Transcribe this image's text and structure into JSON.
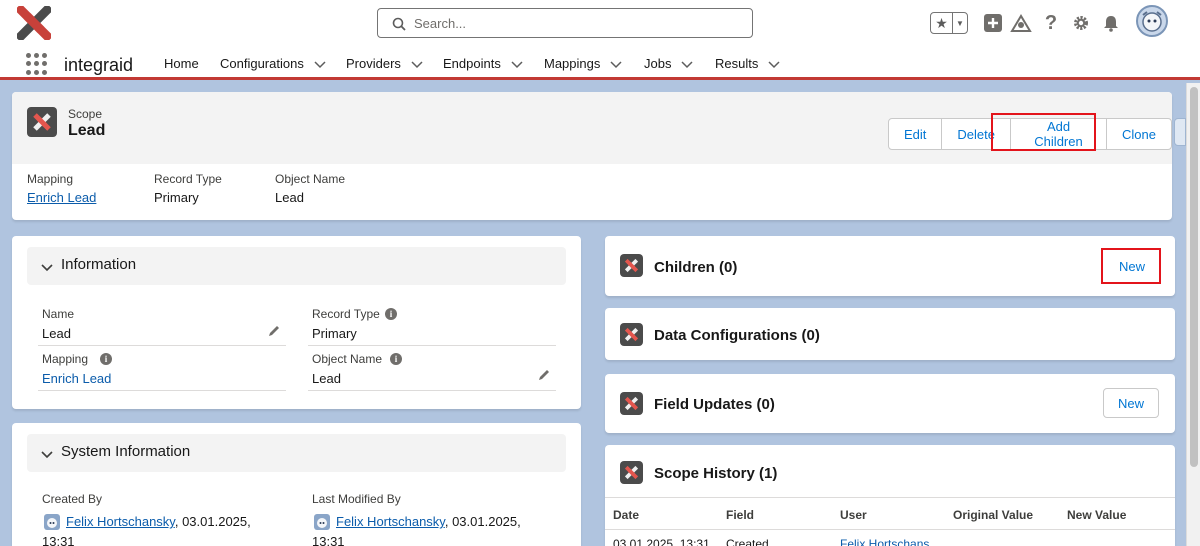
{
  "header": {
    "search_placeholder": "Search...",
    "icons": [
      "favorites-star-icon",
      "favorites-dropdown-icon",
      "global-add-icon",
      "trailhead-icon",
      "help-icon",
      "setup-gear-icon",
      "notifications-bell-icon",
      "user-avatar"
    ]
  },
  "nav": {
    "app_name": "integraid",
    "items": [
      {
        "label": "Home",
        "has_menu": false
      },
      {
        "label": "Configurations",
        "has_menu": true
      },
      {
        "label": "Providers",
        "has_menu": true
      },
      {
        "label": "Endpoints",
        "has_menu": true
      },
      {
        "label": "Mappings",
        "has_menu": true
      },
      {
        "label": "Jobs",
        "has_menu": true
      },
      {
        "label": "Results",
        "has_menu": true
      }
    ]
  },
  "record": {
    "object_label": "Scope",
    "name": "Lead",
    "actions": {
      "edit": "Edit",
      "delete": "Delete",
      "add_children": "Add Children",
      "clone": "Clone"
    },
    "highlights": [
      {
        "label": "Mapping",
        "value": "Enrich Lead",
        "is_link": true
      },
      {
        "label": "Record Type",
        "value": "Primary",
        "is_link": false
      },
      {
        "label": "Object Name",
        "value": "Lead",
        "is_link": false
      }
    ]
  },
  "information": {
    "title": "Information",
    "fields": {
      "name": {
        "label": "Name",
        "value": "Lead"
      },
      "record_type": {
        "label": "Record Type",
        "value": "Primary"
      },
      "mapping": {
        "label": "Mapping",
        "value": "Enrich Lead"
      },
      "object_name": {
        "label": "Object Name",
        "value": "Lead"
      }
    }
  },
  "system_information": {
    "title": "System Information",
    "created_by": {
      "label": "Created By",
      "user": "Felix Hortschansky",
      "date": ", 03.01.2025,",
      "time": "13:31"
    },
    "last_modified_by": {
      "label": "Last Modified By",
      "user": "Felix Hortschansky",
      "date": ", 03.01.2025,",
      "time": "13:31"
    }
  },
  "related_lists": {
    "children": {
      "title": "Children (0)",
      "new_label": "New"
    },
    "data_configurations": {
      "title": "Data Configurations (0)"
    },
    "field_updates": {
      "title": "Field Updates (0)",
      "new_label": "New"
    },
    "scope_history": {
      "title": "Scope History (1)",
      "columns": [
        "Date",
        "Field",
        "User",
        "Original Value",
        "New Value"
      ],
      "rows": [
        {
          "date": "03.01.2025, 13:31",
          "field": "Created",
          "user": "Felix Hortschans"
        }
      ]
    }
  },
  "colors": {
    "accent_blue": "#0176d3",
    "link_blue": "#0b5cab",
    "highlight_red": "#e3141b",
    "nav_underline": "#c23934",
    "brand_red": "#c8413a"
  }
}
